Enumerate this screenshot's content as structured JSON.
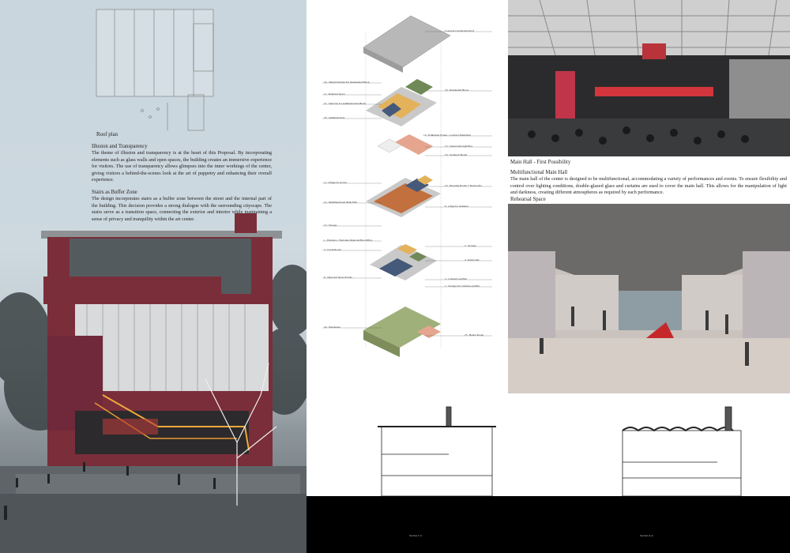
{
  "roof_plan": {
    "label": "Roof plan"
  },
  "illusion": {
    "title": "Illusion and Transparency",
    "body": "The theme of illusion and transparency is at the heart of this Proposal. By incorporating elements such as glass walls and open spaces, the building creates an immersive experience for visitors. The use of transparency allows glimpses into the inner workings of the center, giving visitors a behind-the-scenes look at the art of puppetry and enhancing their overall experience."
  },
  "stairs": {
    "title": "Stairs as Buffer Zone",
    "body": "The design incorporates stairs as a buffer zone between the street and the internal part of the building. This decision provides a strong dialogue with the surrounding cityscape. The stairs serve as a transition space, connecting the exterior and interior while maintaining a sense of privacy and tranquility within the art center."
  },
  "exploded": {
    "labels_left": [
      "19 . Shared Kitchen For Residential Block",
      "17 . Rehersal Space",
      "21 . Staircase for Administration Block",
      "20 . Administration",
      "11 . Wings for Actors",
      "12 . Multifunctional Main Hall",
      "13 . Storage",
      "1 . Entrance - Welcome Desk and Box Office",
      "3 . Cloak Room",
      "6 . Open Air Space Events",
      "24 . Warehouse"
    ],
    "labels_right": [
      "Concrete Curtain-like Roof",
      "18 . Residential Block",
      "14 . Exhibition Events - Corridor Exhibition",
      "15 . Sound and Light Box",
      "16 . Technical Booth",
      "10 . Dressing Rooms + Restrooms",
      "9 . wings for audience",
      "2 . Storage",
      "4 . Restrooms",
      "5 . Cafeteria and Bar",
      "7 . Storage for Cafeteria and Bar",
      "23 . Heater Room"
    ]
  },
  "main_hall": {
    "caption": "Main Hall - First Possibility",
    "title": "Multifunctional Main Hall",
    "body": "The main hall of the center is designed to be multifunctional, accommodating a variety of performances and events. To ensure flexibility and control over lighting conditions, double-glazed glass and curtains are used to cover the main hall. This allows for the manipulation of light and darkness, creating different atmospheres as required by each performance."
  },
  "rehearsal": {
    "caption": "Rehearsal Space"
  },
  "sections": {
    "left_label": "Section C-C",
    "right_label": "Section A-A"
  },
  "colors": {
    "brick": "#7a2e3a",
    "sky": "#c9d6de",
    "green_block": "#6f8a56",
    "orange_block": "#c2703d",
    "blue_block": "#45597a",
    "yellow_block": "#e3b25a",
    "pink_block": "#e6a58f"
  }
}
